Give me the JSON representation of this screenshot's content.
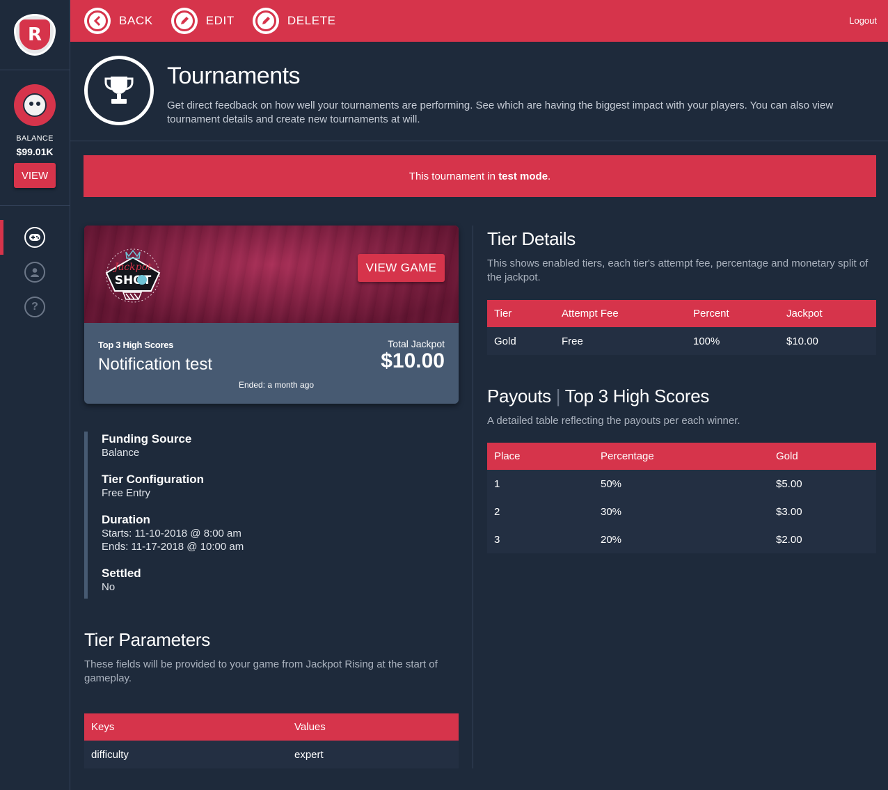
{
  "sidebar": {
    "balance_label": "BALANCE",
    "balance_value": "$99.01K",
    "view_label": "VIEW",
    "nav": [
      {
        "icon": "gamepad-icon"
      },
      {
        "icon": "user-icon"
      },
      {
        "icon": "help-icon",
        "glyph": "?"
      }
    ]
  },
  "topbar": {
    "back_label": "BACK",
    "edit_label": "EDIT",
    "delete_label": "DELETE",
    "logout_label": "Logout"
  },
  "header": {
    "title": "Tournaments",
    "description": "Get direct feedback on how well your tournaments are performing. See which are having the biggest impact with your players. You can also view tournament details and create new tournaments at will."
  },
  "banner": {
    "prefix": "This tournament in ",
    "emphasis": "test mode",
    "suffix": "."
  },
  "card": {
    "view_game_label": "VIEW GAME",
    "subtitle": "Top 3 High Scores",
    "name": "Notification test",
    "ended": "Ended: a month ago",
    "jackpot_label": "Total Jackpot",
    "jackpot_value": "$10.00",
    "game_logo_word1": "Jackpot",
    "game_logo_word2": "SHOT"
  },
  "details": {
    "funding_label": "Funding Source",
    "funding_value": "Balance",
    "tier_config_label": "Tier Configuration",
    "tier_config_value": "Free Entry",
    "duration_label": "Duration",
    "duration_start": "Starts: 11-10-2018 @ 8:00 am",
    "duration_end": "Ends: 11-17-2018 @ 10:00 am",
    "settled_label": "Settled",
    "settled_value": "No"
  },
  "tier_parameters": {
    "title": "Tier Parameters",
    "description": "These fields will be provided to your game from Jackpot Rising at the start of gameplay.",
    "headers": [
      "Keys",
      "Values"
    ],
    "rows": [
      [
        "difficulty",
        "expert"
      ]
    ]
  },
  "tier_details": {
    "title": "Tier Details",
    "description": "This shows enabled tiers, each tier's attempt fee, percentage and monetary split of the jackpot.",
    "headers": [
      "Tier",
      "Attempt Fee",
      "Percent",
      "Jackpot"
    ],
    "rows": [
      [
        "Gold",
        "Free",
        "100%",
        "$10.00"
      ]
    ]
  },
  "payouts": {
    "title_main": "Payouts",
    "title_sep": "|",
    "title_sub": "Top 3 High Scores",
    "description": "A detailed table reflecting the payouts per each winner.",
    "headers": [
      "Place",
      "Percentage",
      "Gold"
    ],
    "rows": [
      [
        "1",
        "50%",
        "$5.00"
      ],
      [
        "2",
        "30%",
        "$3.00"
      ],
      [
        "3",
        "20%",
        "$2.00"
      ]
    ]
  },
  "colors": {
    "accent": "#d6344b",
    "background": "#1e2a3b",
    "card_body": "#475a72"
  }
}
